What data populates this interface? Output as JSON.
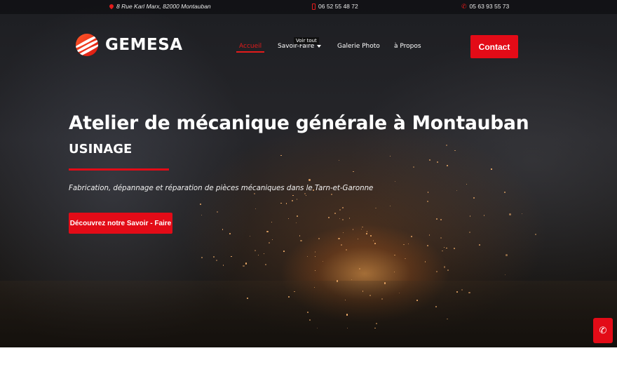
{
  "topbar": {
    "address": "8 Rue Karl Marx, 82000 Montauban",
    "mobile": "06 52 55 48 72",
    "phone": "05 63 93 55 73",
    "icons": {
      "address": "map-pin-icon",
      "mobile": "mobile-icon",
      "phone": "phone-icon"
    }
  },
  "brand": {
    "name": "GEMESA"
  },
  "nav": {
    "items": [
      {
        "label": "Accueil",
        "active": true
      },
      {
        "label": "Savoir-Faire",
        "active": false
      },
      {
        "label": "Galerie Photo",
        "active": false
      },
      {
        "label": "à Propos",
        "active": false
      }
    ],
    "tooltip": "Voir tout",
    "contact_label": "Contact"
  },
  "hero": {
    "title": "Atelier de mécanique générale à Montauban",
    "subtitle": "USINAGE",
    "description": "Fabrication, dépannage et réparation de pièces mécaniques dans le Tarn-et-Garonne",
    "cta_label": "Découvrez notre Savoir - Faire"
  },
  "floating": {
    "icon": "phone-icon"
  },
  "colors": {
    "accent": "#e30b17",
    "text": "#ffffff",
    "dark": "#1d1e22"
  }
}
